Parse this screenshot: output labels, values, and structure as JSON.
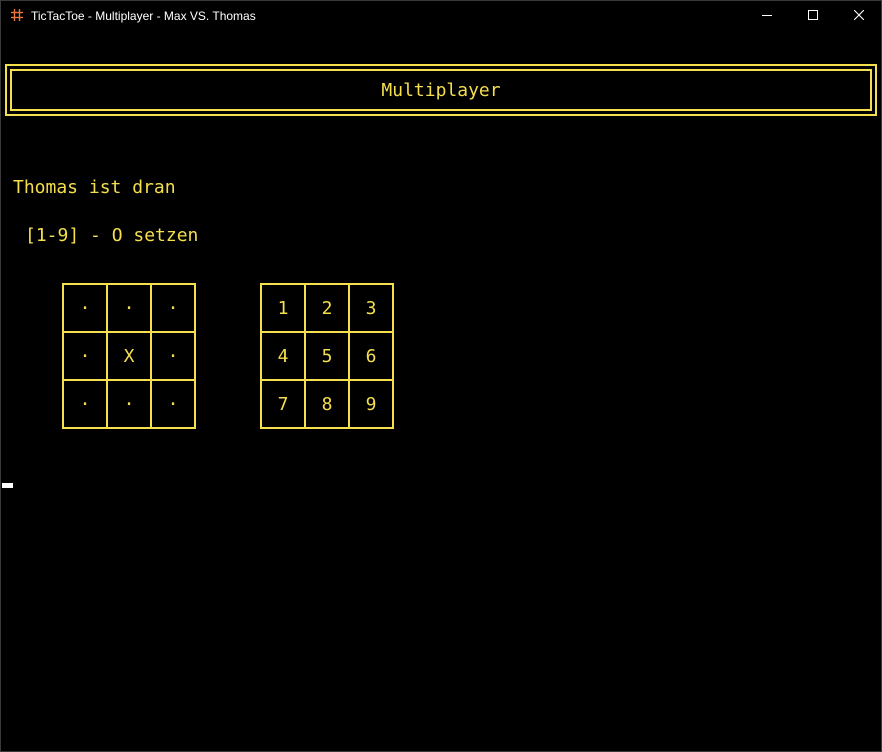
{
  "window": {
    "title": "TicTacToe - Multiplayer - Max VS. Thomas",
    "icon": "hash-icon",
    "controls": [
      "minimize-icon",
      "maximize-icon",
      "close-icon"
    ]
  },
  "colors": {
    "text": "#f5df4d",
    "background": "#000000"
  },
  "console": {
    "header": "Multiplayer",
    "turn_message": "Thomas ist dran",
    "hint": "[1-9] - O setzen",
    "board": [
      "·",
      "·",
      "·",
      "·",
      "X",
      "·",
      "·",
      "·",
      "·"
    ],
    "key_grid": [
      "1",
      "2",
      "3",
      "4",
      "5",
      "6",
      "7",
      "8",
      "9"
    ]
  }
}
